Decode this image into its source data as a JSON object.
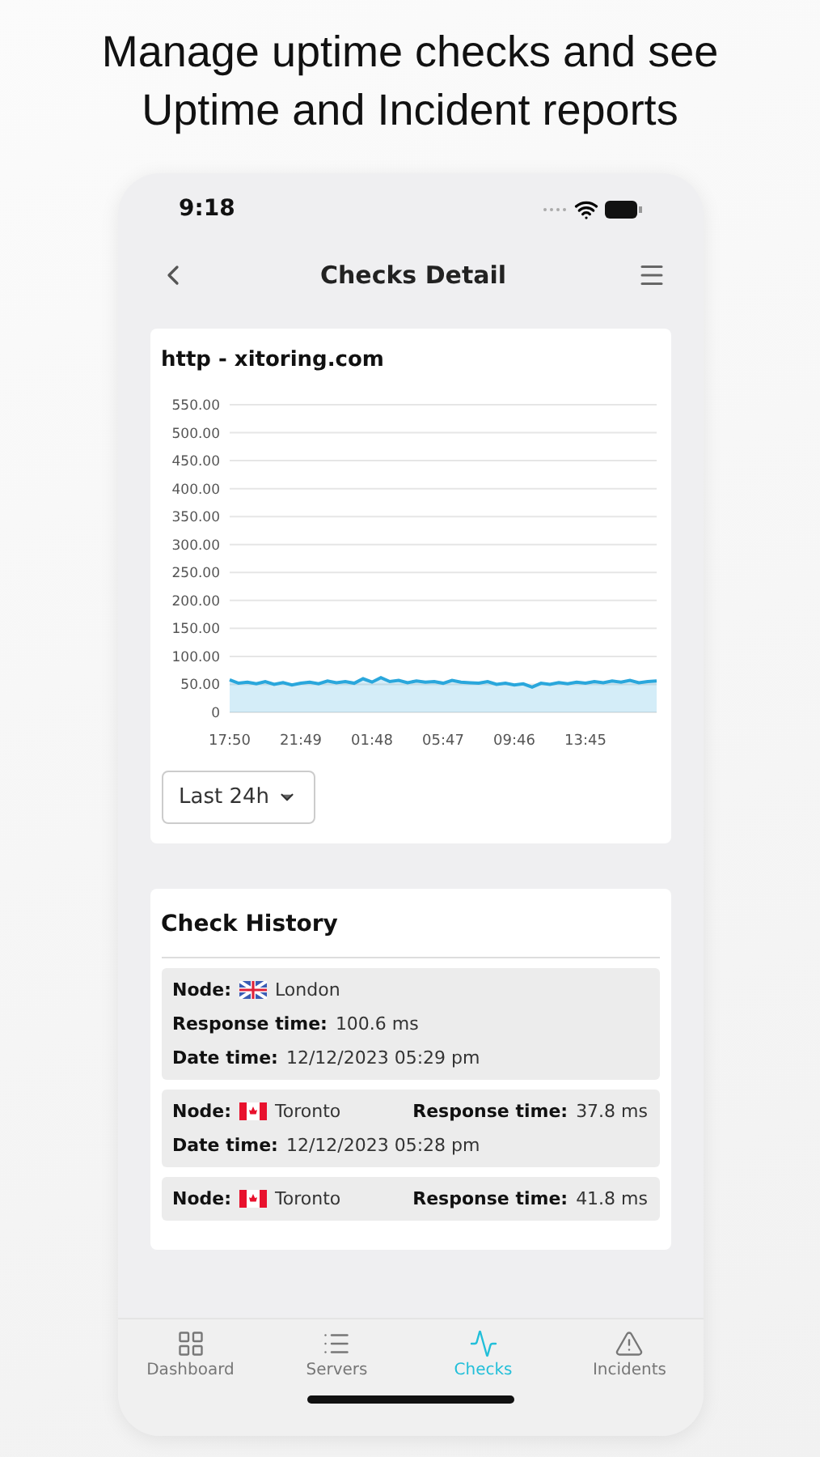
{
  "headline": [
    "Manage uptime checks and see",
    "Uptime and Incident reports"
  ],
  "status_bar": {
    "time": "9:18"
  },
  "nav": {
    "title": "Checks Detail"
  },
  "check_card": {
    "title": "http - xitoring.com",
    "chart_data": {
      "type": "area",
      "categories": [
        "17:50",
        null,
        null,
        null,
        null,
        null,
        null,
        null,
        "21:49",
        null,
        null,
        null,
        null,
        null,
        null,
        null,
        "01:48",
        null,
        null,
        null,
        null,
        null,
        null,
        null,
        "05:47",
        null,
        null,
        null,
        null,
        null,
        null,
        null,
        "09:46",
        null,
        null,
        null,
        null,
        null,
        null,
        null,
        "13:45",
        null,
        null,
        null,
        null,
        null,
        null,
        null,
        null
      ],
      "series": [
        {
          "color": "#2aa7dc",
          "values": [
            58,
            52,
            54,
            51,
            55,
            50,
            53,
            49,
            52,
            54,
            51,
            56,
            53,
            55,
            52,
            60,
            54,
            62,
            55,
            57,
            53,
            56,
            54,
            55,
            52,
            57,
            54,
            53,
            52,
            55,
            50,
            52,
            49,
            51,
            45,
            52,
            50,
            53,
            51,
            54,
            52,
            55,
            53,
            56,
            54,
            57,
            53,
            55,
            56
          ]
        }
      ],
      "ylim": [
        0,
        550
      ],
      "yticks": [
        {
          "value": 0,
          "label": "0"
        },
        {
          "value": 50,
          "label": "50.00"
        },
        {
          "value": 100,
          "label": "100.00"
        },
        {
          "value": 150,
          "label": "150.00"
        },
        {
          "value": 200,
          "label": "200.00"
        },
        {
          "value": 250,
          "label": "250.00"
        },
        {
          "value": 300,
          "label": "300.00"
        },
        {
          "value": 350,
          "label": "350.00"
        },
        {
          "value": 400,
          "label": "400.00"
        },
        {
          "value": 450,
          "label": "450.00"
        },
        {
          "value": 500,
          "label": "500.00"
        },
        {
          "value": 550,
          "label": "550.00"
        }
      ],
      "grid": true
    },
    "range_select": {
      "value": "Last 24h"
    }
  },
  "history": {
    "title": "Check History",
    "items": [
      {
        "kind": "stacked",
        "node_label": "Node:",
        "flag": {
          "kind": "gb"
        },
        "node": "London",
        "response_label": "Response time:",
        "response": "100.6 ms",
        "date_label": "Date time:",
        "date": "12/12/2023 05:29 pm"
      },
      {
        "kind": "inline",
        "node_label": "Node:",
        "flag": {
          "kind": "ca"
        },
        "node": "Toronto",
        "response_label": "Response time:",
        "response": "37.8 ms",
        "date_label": "Date time:",
        "date": "12/12/2023 05:28 pm"
      },
      {
        "kind": "inline",
        "node_label": "Node:",
        "flag": {
          "kind": "ca"
        },
        "node": "Toronto",
        "response_label": "Response time:",
        "response": "41.8 ms"
      }
    ]
  },
  "tab_bar": [
    {
      "label": "Dashboard",
      "selected": false
    },
    {
      "label": "Servers",
      "selected": false
    },
    {
      "label": "Checks",
      "selected": true
    },
    {
      "label": "Incidents",
      "selected": false
    }
  ]
}
